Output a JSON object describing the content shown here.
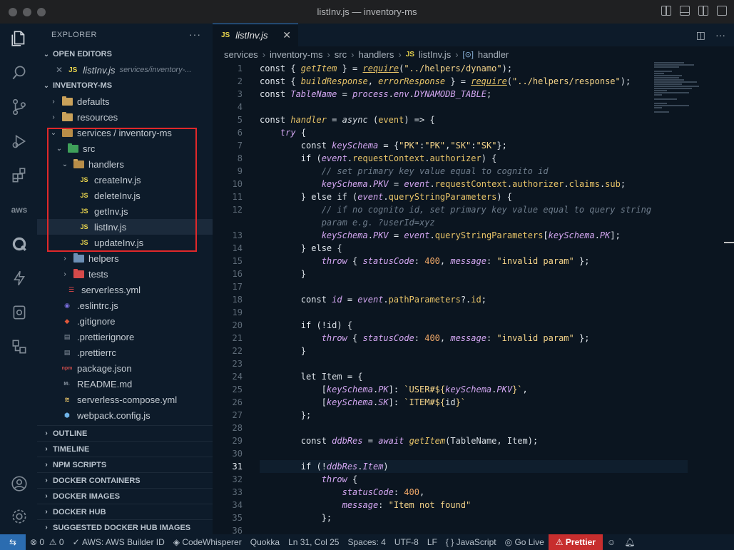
{
  "window": {
    "title": "listInv.js — inventory-ms"
  },
  "explorer": {
    "header": "EXPLORER",
    "open_editors_label": "OPEN EDITORS",
    "open_editor_file": "listInv.js",
    "open_editor_path": "services/inventory-...",
    "project_label": "INVENTORY-MS",
    "tree": {
      "defaults": "defaults",
      "resources": "resources",
      "services": "services / inventory-ms",
      "src": "src",
      "handlers": "handlers",
      "createInv": "createInv.js",
      "deleteInv": "deleteInv.js",
      "getInv": "getInv.js",
      "listInv": "listInv.js",
      "updateInv": "updateInv.js",
      "helpers": "helpers",
      "tests": "tests",
      "serverless": "serverless.yml",
      "eslintrc": ".eslintrc.js",
      "gitignore": ".gitignore",
      "prettierignore": ".prettierignore",
      "prettierrc": ".prettierrc",
      "package": "package.json",
      "readme": "README.md",
      "compose": "serverless-compose.yml",
      "webpack": "webpack.config.js"
    },
    "sections": [
      "OUTLINE",
      "TIMELINE",
      "NPM SCRIPTS",
      "DOCKER CONTAINERS",
      "DOCKER IMAGES",
      "DOCKER HUB",
      "SUGGESTED DOCKER HUB IMAGES"
    ]
  },
  "editor": {
    "tab_label": "listInv.js",
    "breadcrumb": [
      "services",
      "inventory-ms",
      "src",
      "handlers",
      "listInv.js",
      "handler"
    ]
  },
  "statusbar": {
    "errors": "0",
    "warnings": "0",
    "aws": "AWS: AWS Builder ID",
    "codewhisperer": "CodeWhisperer",
    "quokka": "Quokka",
    "position": "Ln 31, Col 25",
    "spaces": "Spaces: 4",
    "encoding": "UTF-8",
    "eol": "LF",
    "language": "JavaScript",
    "golive": "Go Live",
    "prettier": "Prettier"
  },
  "colors": {
    "accent": "#2b6cb0",
    "highlight_box": "#e0282a",
    "prettier_bg": "#c72e2e"
  }
}
